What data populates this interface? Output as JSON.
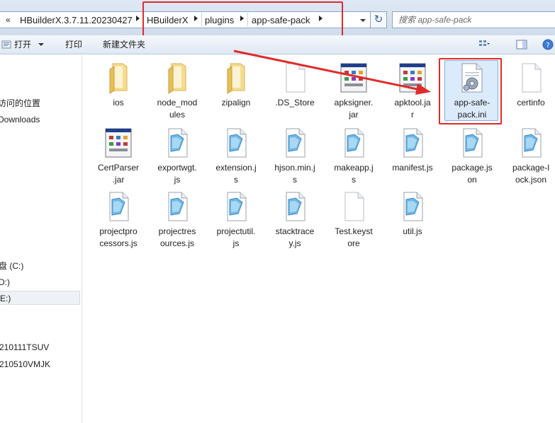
{
  "address_bar": {
    "overflow_glyph": "«",
    "segments": [
      "HBuilderX.3.7.11.20230427",
      "HBuilderX",
      "plugins",
      "app-safe-pack"
    ],
    "refresh_icon": "refresh-icon"
  },
  "search": {
    "placeholder": "搜索 app-safe-pack"
  },
  "toolbar": {
    "open_label": "打开",
    "print_label": "打印",
    "new_folder_label": "新建文件夹"
  },
  "nav": {
    "items": [
      "访问的位置",
      "Downloads",
      "盘 (C:)",
      "D:)",
      "E:)",
      "210111TSUV",
      "210510VMJK"
    ]
  },
  "files": [
    {
      "name": "ios",
      "kind": "folder"
    },
    {
      "name": "node_modules",
      "kind": "folder"
    },
    {
      "name": "zipalign",
      "kind": "folder"
    },
    {
      "name": ".DS_Store",
      "kind": "blank"
    },
    {
      "name": "apksigner.jar",
      "kind": "jar"
    },
    {
      "name": "apktool.jar",
      "kind": "jar"
    },
    {
      "name": "app-safe-pack.ini",
      "kind": "ini"
    },
    {
      "name": "certinfo",
      "kind": "blank"
    },
    {
      "name": "CertParser.jar",
      "kind": "jar"
    },
    {
      "name": "exportwgt.js",
      "kind": "js"
    },
    {
      "name": "extension.js",
      "kind": "js"
    },
    {
      "name": "hjson.min.js",
      "kind": "js"
    },
    {
      "name": "makeapp.js",
      "kind": "js"
    },
    {
      "name": "manifest.js",
      "kind": "js"
    },
    {
      "name": "package.json",
      "kind": "js"
    },
    {
      "name": "package-lock.json",
      "kind": "js"
    },
    {
      "name": "projectprocessors.js",
      "kind": "js"
    },
    {
      "name": "projectresources.js",
      "kind": "js"
    },
    {
      "name": "projectutil.js",
      "kind": "js"
    },
    {
      "name": "stacktrace.js",
      "kind": "js"
    },
    {
      "name": "Test.keystore",
      "kind": "blank"
    },
    {
      "name": "util.js",
      "kind": "js"
    }
  ],
  "file_labels_wrapped": {
    "ios": [
      "ios"
    ],
    "node_modules": [
      "node_mod",
      "ules"
    ],
    "zipalign": [
      "zipalign"
    ],
    ".DS_Store": [
      ".DS_Store"
    ],
    "apksigner.jar": [
      "apksigner.",
      "jar"
    ],
    "apktool.jar": [
      "apktool.ja",
      "r"
    ],
    "app-safe-pack.ini": [
      "app-safe-",
      "pack.ini"
    ],
    "certinfo": [
      "certinfo"
    ],
    "CertParser.jar": [
      "CertParser",
      ".jar"
    ],
    "exportwgt.js": [
      "exportwgt.",
      "js"
    ],
    "extension.js": [
      "extension.j",
      "s"
    ],
    "hjson.min.js": [
      "hjson.min.j",
      "s"
    ],
    "makeapp.js": [
      "makeapp.j",
      "s"
    ],
    "manifest.js": [
      "manifest.js"
    ],
    "package.json": [
      "package.js",
      "on"
    ],
    "package-lock.json": [
      "package-l",
      "ock.json"
    ],
    "projectprocessors.js": [
      "projectpro",
      "cessors.js"
    ],
    "projectresources.js": [
      "projectres",
      "ources.js"
    ],
    "projectutil.js": [
      "projectutil.",
      "js"
    ],
    "stacktrace.js": [
      "stacktrace",
      "y.js"
    ],
    "Test.keystore": [
      "Test.keyst",
      "ore"
    ],
    "util.js": [
      "util.js"
    ]
  },
  "colors": {
    "annotation_red": "#e02a2a",
    "selection_fill": "#dcebfc",
    "folder_yellow": "#f3d27a",
    "js_blue": "#4d9fd6"
  }
}
